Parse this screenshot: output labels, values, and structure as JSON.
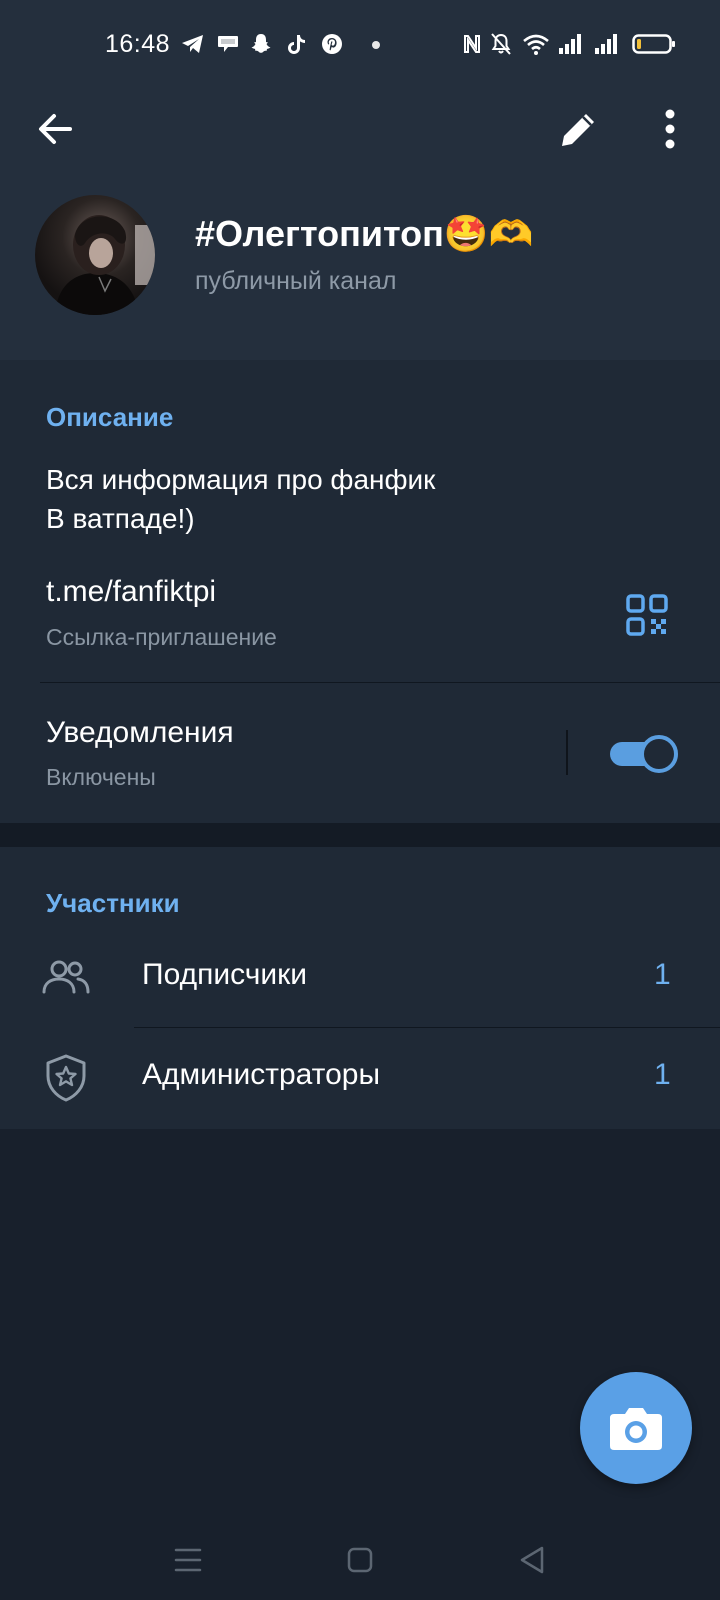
{
  "status_bar": {
    "time": "16:48",
    "app_icons": [
      "telegram-icon",
      "chat-bubble-icon",
      "snapchat-icon",
      "tiktok-icon",
      "pinterest-icon"
    ],
    "system_icons": [
      "nfc-icon",
      "bell-off-icon",
      "wifi-icon",
      "signal-icon",
      "signal-icon",
      "battery-icon"
    ]
  },
  "toolbar": {
    "back_icon": "arrow-left-icon",
    "edit_icon": "pencil-icon",
    "more_icon": "dots-vertical-icon"
  },
  "channel": {
    "name": "#Олегтопитоп🤩🫶",
    "type": "публичный канал"
  },
  "info": {
    "description_title": "Описание",
    "description_line1": "Вся информация про фанфик",
    "description_line2": "В ватпаде!)",
    "link": "t.me/fanfiktpi",
    "link_caption": "Ссылка-приглашение",
    "qr_icon": "qr-code-icon",
    "notifications_label": "Уведомления",
    "notifications_status": "Включены",
    "notifications_enabled": true
  },
  "members": {
    "title": "Участники",
    "rows": [
      {
        "label": "Подписчики",
        "count": "1",
        "icon": "users-icon"
      },
      {
        "label": "Администраторы",
        "count": "1",
        "icon": "shield-star-icon"
      }
    ]
  },
  "fab": {
    "icon": "camera-icon"
  },
  "navigation": {
    "buttons": [
      "menu-icon",
      "home-square-icon",
      "back-triangle-icon"
    ]
  },
  "colors": {
    "accent": "#6fb1f0",
    "header_bg": "#242f3d",
    "section_bg": "#1f2936",
    "page_bg": "#18202c",
    "fab": "#5aa0e6"
  }
}
